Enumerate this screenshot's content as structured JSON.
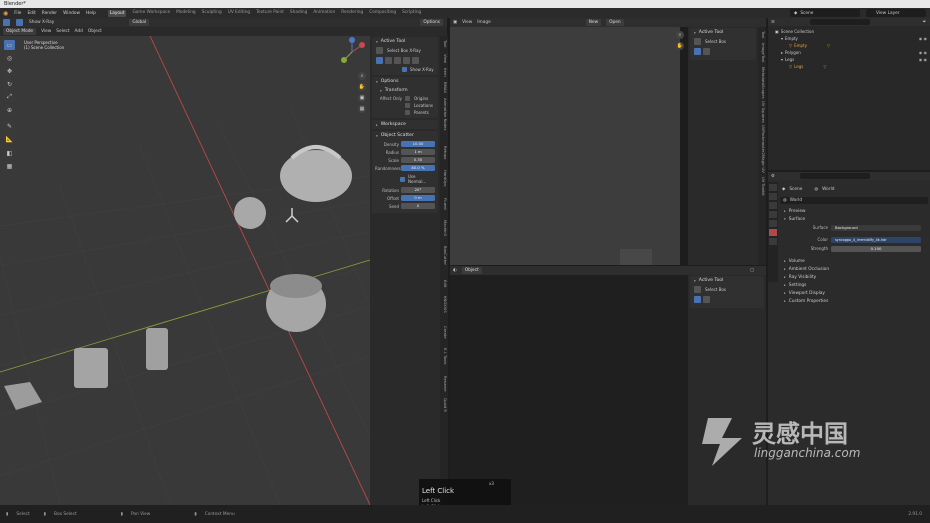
{
  "window_title": "Blender*",
  "menu": [
    "File",
    "Edit",
    "Render",
    "Window",
    "Help"
  ],
  "workspaces": [
    "Layout",
    "Game Workspace",
    "Modeling",
    "Sculpting",
    "UV Editing",
    "Texture Paint",
    "Shading",
    "Animation",
    "Rendering",
    "Compositing",
    "Scripting"
  ],
  "scene": {
    "icon": "scene-icon",
    "label": "Scene"
  },
  "view_layer": "View Layer",
  "viewport_header": {
    "show_xray": "Show X-Ray",
    "orientation": "Global",
    "mode": "Object Mode",
    "menus": [
      "View",
      "Select",
      "Add",
      "Object"
    ],
    "options": "Options"
  },
  "viewport_info": {
    "line1": "User Perspective",
    "line2": "(1) Scene Collection"
  },
  "tool_panel": {
    "active_tool": "Active Tool",
    "select_box": "Select Box X-Ray",
    "show_xray": "Show X-Ray",
    "options": "Options",
    "transform": "Transform",
    "affect_only": "Affect Only",
    "origins": "Origins",
    "locations": "Locations",
    "parents": "Parents",
    "workspace": "Workspace",
    "object_scatter": "Object Scatter",
    "fields": [
      {
        "label": "Density",
        "value": "10.00"
      },
      {
        "label": "Radius",
        "value": "1 m"
      },
      {
        "label": "Scale",
        "value": "0.30"
      },
      {
        "label": "Randomness",
        "value": "80.0 %"
      }
    ],
    "use_normal": "Use Normal...",
    "fields2": [
      {
        "label": "Rotation",
        "value": "20°"
      },
      {
        "label": "Offset",
        "value": "0 m"
      },
      {
        "label": "Seed",
        "value": "0"
      }
    ]
  },
  "side_tabs": [
    "Tool",
    "View",
    "Item",
    "BMAX",
    "Animation Nodes",
    "Retopo",
    "HardOps",
    "Fluent",
    "Machin3",
    "BoxCutter",
    "Edit",
    "KNOXXIS",
    "Create",
    "E.I. Tools",
    "Rename",
    "Quad R"
  ],
  "image_editor": {
    "menus": [
      "View",
      "Image"
    ],
    "new": "New",
    "open": "Open",
    "active_tool": "Active Tool",
    "select_box": "Select Box"
  },
  "image_side_tabs": [
    "Tool",
    "Image",
    "Tool",
    "Metadata",
    "Scopes",
    "UV Squares",
    "UVPackmaster2",
    "Magic UV",
    "UV Toolkit"
  ],
  "node_editor": {
    "mode": "Object",
    "active_tool": "Active Tool",
    "select_box": "Select Box"
  },
  "outliner": [
    {
      "indent": 0,
      "label": "Scene Collection",
      "icon": "collection-icon",
      "color": "#c8c8c8"
    },
    {
      "indent": 1,
      "label": "Empty",
      "icon": "object-icon",
      "color": "#c8c8c8"
    },
    {
      "indent": 2,
      "label": "Empty",
      "icon": "mesh-icon",
      "color": "#e8a040"
    },
    {
      "indent": 1,
      "label": "Polygon",
      "icon": "object-icon",
      "color": "#c8c8c8"
    },
    {
      "indent": 1,
      "label": "Legs",
      "icon": "object-icon",
      "color": "#c8c8c8"
    },
    {
      "indent": 2,
      "label": "Legs",
      "icon": "mesh-icon",
      "color": "#e8a040"
    }
  ],
  "properties": {
    "scene_label": "Scene",
    "world_label": "World",
    "world_name": "World",
    "preview": "Preview",
    "surface": "Surface",
    "surface_label": "Surface",
    "surface_value": "Background",
    "color_label": "Color",
    "color_value": "syncogpo_4_Irremidlify_4k.hdr",
    "strength_label": "Strength",
    "strength_value": "0.100",
    "sections": [
      "Volume",
      "Ambient Occlusion",
      "Ray Visibility",
      "Settings",
      "Viewport Display",
      "Custom Properties"
    ]
  },
  "key_overlay": {
    "title": "Left Click",
    "line1": "Left Click",
    "line2": "Left Click",
    "count": "x3"
  },
  "status": {
    "select": "Select",
    "box_select": "Box Select",
    "pan_view": "Pan View",
    "context_menu": "Context Menu",
    "version": "2.91.0"
  },
  "watermark": {
    "cn": "灵感中国",
    "url": "lingganchina.com"
  },
  "colors": {
    "accent": "#4772b3",
    "x_axis": "#c84a4a",
    "y_axis": "#8aa83a"
  }
}
